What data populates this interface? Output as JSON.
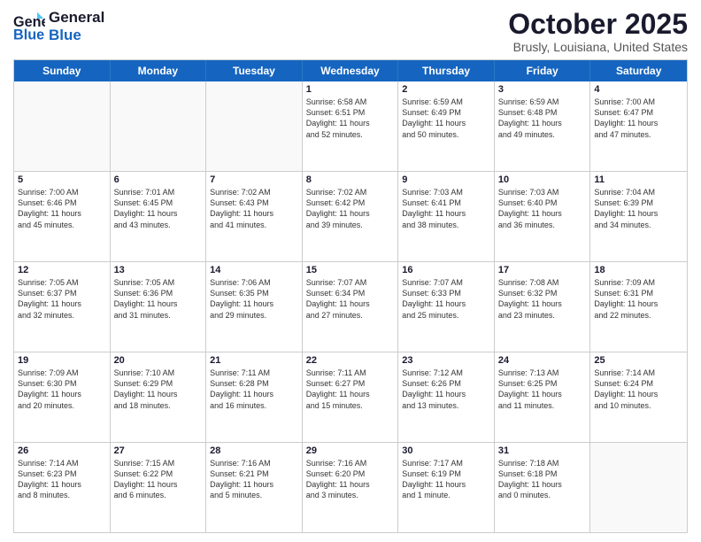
{
  "header": {
    "logo_line1": "General",
    "logo_line2": "Blue",
    "month_title": "October 2025",
    "location": "Brusly, Louisiana, United States"
  },
  "days_of_week": [
    "Sunday",
    "Monday",
    "Tuesday",
    "Wednesday",
    "Thursday",
    "Friday",
    "Saturday"
  ],
  "weeks": [
    [
      {
        "day": "",
        "text": ""
      },
      {
        "day": "",
        "text": ""
      },
      {
        "day": "",
        "text": ""
      },
      {
        "day": "1",
        "text": "Sunrise: 6:58 AM\nSunset: 6:51 PM\nDaylight: 11 hours\nand 52 minutes."
      },
      {
        "day": "2",
        "text": "Sunrise: 6:59 AM\nSunset: 6:49 PM\nDaylight: 11 hours\nand 50 minutes."
      },
      {
        "day": "3",
        "text": "Sunrise: 6:59 AM\nSunset: 6:48 PM\nDaylight: 11 hours\nand 49 minutes."
      },
      {
        "day": "4",
        "text": "Sunrise: 7:00 AM\nSunset: 6:47 PM\nDaylight: 11 hours\nand 47 minutes."
      }
    ],
    [
      {
        "day": "5",
        "text": "Sunrise: 7:00 AM\nSunset: 6:46 PM\nDaylight: 11 hours\nand 45 minutes."
      },
      {
        "day": "6",
        "text": "Sunrise: 7:01 AM\nSunset: 6:45 PM\nDaylight: 11 hours\nand 43 minutes."
      },
      {
        "day": "7",
        "text": "Sunrise: 7:02 AM\nSunset: 6:43 PM\nDaylight: 11 hours\nand 41 minutes."
      },
      {
        "day": "8",
        "text": "Sunrise: 7:02 AM\nSunset: 6:42 PM\nDaylight: 11 hours\nand 39 minutes."
      },
      {
        "day": "9",
        "text": "Sunrise: 7:03 AM\nSunset: 6:41 PM\nDaylight: 11 hours\nand 38 minutes."
      },
      {
        "day": "10",
        "text": "Sunrise: 7:03 AM\nSunset: 6:40 PM\nDaylight: 11 hours\nand 36 minutes."
      },
      {
        "day": "11",
        "text": "Sunrise: 7:04 AM\nSunset: 6:39 PM\nDaylight: 11 hours\nand 34 minutes."
      }
    ],
    [
      {
        "day": "12",
        "text": "Sunrise: 7:05 AM\nSunset: 6:37 PM\nDaylight: 11 hours\nand 32 minutes."
      },
      {
        "day": "13",
        "text": "Sunrise: 7:05 AM\nSunset: 6:36 PM\nDaylight: 11 hours\nand 31 minutes."
      },
      {
        "day": "14",
        "text": "Sunrise: 7:06 AM\nSunset: 6:35 PM\nDaylight: 11 hours\nand 29 minutes."
      },
      {
        "day": "15",
        "text": "Sunrise: 7:07 AM\nSunset: 6:34 PM\nDaylight: 11 hours\nand 27 minutes."
      },
      {
        "day": "16",
        "text": "Sunrise: 7:07 AM\nSunset: 6:33 PM\nDaylight: 11 hours\nand 25 minutes."
      },
      {
        "day": "17",
        "text": "Sunrise: 7:08 AM\nSunset: 6:32 PM\nDaylight: 11 hours\nand 23 minutes."
      },
      {
        "day": "18",
        "text": "Sunrise: 7:09 AM\nSunset: 6:31 PM\nDaylight: 11 hours\nand 22 minutes."
      }
    ],
    [
      {
        "day": "19",
        "text": "Sunrise: 7:09 AM\nSunset: 6:30 PM\nDaylight: 11 hours\nand 20 minutes."
      },
      {
        "day": "20",
        "text": "Sunrise: 7:10 AM\nSunset: 6:29 PM\nDaylight: 11 hours\nand 18 minutes."
      },
      {
        "day": "21",
        "text": "Sunrise: 7:11 AM\nSunset: 6:28 PM\nDaylight: 11 hours\nand 16 minutes."
      },
      {
        "day": "22",
        "text": "Sunrise: 7:11 AM\nSunset: 6:27 PM\nDaylight: 11 hours\nand 15 minutes."
      },
      {
        "day": "23",
        "text": "Sunrise: 7:12 AM\nSunset: 6:26 PM\nDaylight: 11 hours\nand 13 minutes."
      },
      {
        "day": "24",
        "text": "Sunrise: 7:13 AM\nSunset: 6:25 PM\nDaylight: 11 hours\nand 11 minutes."
      },
      {
        "day": "25",
        "text": "Sunrise: 7:14 AM\nSunset: 6:24 PM\nDaylight: 11 hours\nand 10 minutes."
      }
    ],
    [
      {
        "day": "26",
        "text": "Sunrise: 7:14 AM\nSunset: 6:23 PM\nDaylight: 11 hours\nand 8 minutes."
      },
      {
        "day": "27",
        "text": "Sunrise: 7:15 AM\nSunset: 6:22 PM\nDaylight: 11 hours\nand 6 minutes."
      },
      {
        "day": "28",
        "text": "Sunrise: 7:16 AM\nSunset: 6:21 PM\nDaylight: 11 hours\nand 5 minutes."
      },
      {
        "day": "29",
        "text": "Sunrise: 7:16 AM\nSunset: 6:20 PM\nDaylight: 11 hours\nand 3 minutes."
      },
      {
        "day": "30",
        "text": "Sunrise: 7:17 AM\nSunset: 6:19 PM\nDaylight: 11 hours\nand 1 minute."
      },
      {
        "day": "31",
        "text": "Sunrise: 7:18 AM\nSunset: 6:18 PM\nDaylight: 11 hours\nand 0 minutes."
      },
      {
        "day": "",
        "text": ""
      }
    ]
  ]
}
